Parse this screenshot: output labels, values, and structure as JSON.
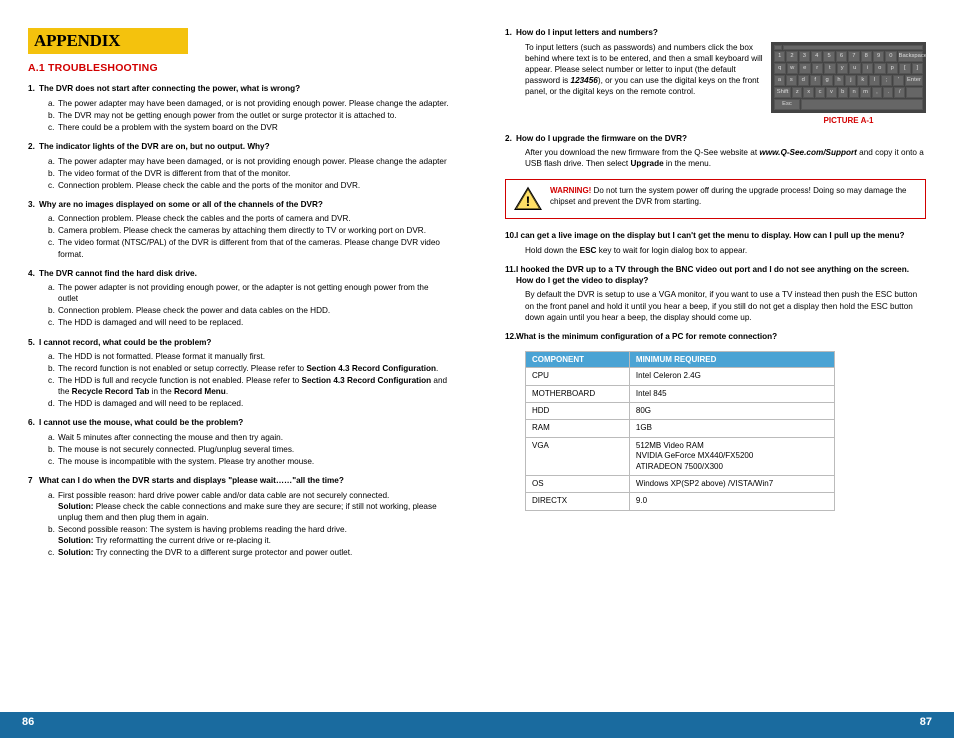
{
  "header": {
    "title": "APPENDIX"
  },
  "section": {
    "title": "A.1 TROUBLESHOOTING"
  },
  "left": {
    "q1": {
      "text": "The DVR does not start after connecting the power, what is wrong?",
      "a": "The power adapter may have been damaged, or is not providing enough power. Please change the adapter.",
      "b": "The DVR may not be getting enough power from the outlet or surge protector it is attached to.",
      "c": "There could be a problem with the system board on the DVR"
    },
    "q2": {
      "text": "The indicator lights of the DVR are on, but no output. Why?",
      "a": "The power adapter may have been damaged, or is not providing enough power. Please change the adapter",
      "b": "The video format of the DVR is different from that of the monitor.",
      "c": "Connection problem. Please check the cable and the ports of the monitor and DVR."
    },
    "q3": {
      "text": "Why are no images displayed on some or all of the channels of the DVR?",
      "a": "Connection problem. Please check the cables and the ports of camera and DVR.",
      "b": "Camera problem. Please check the cameras by attaching them directly to TV or working port on DVR.",
      "c": "The video format (NTSC/PAL) of the DVR is different from that of the cameras. Please change DVR video format."
    },
    "q4": {
      "text": "The DVR cannot find the hard disk drive.",
      "a": "The power adapter is not providing enough power, or the adapter is not getting enough power from the outlet",
      "b": "Connection problem. Please check the power and data cables on the HDD.",
      "c": "The HDD is damaged and will need to be replaced."
    },
    "q5": {
      "text": "I cannot record, what could be the problem?",
      "a": "The HDD is not formatted. Please format it manually first.",
      "b_pre": "The record function is not enabled or setup correctly. Please refer to ",
      "b_bold": "Section 4.3 Record Configuration",
      "b_post": ".",
      "c_pre": "The HDD is full and recycle function is not enabled. Please refer to ",
      "c_b1": "Section 4.3 Record Configuration",
      "c_mid": " and the ",
      "c_b2": "Recycle Record Tab",
      "c_mid2": " in the ",
      "c_b3": "Record Menu",
      "c_post": ".",
      "d": "The HDD is damaged and will need to be replaced."
    },
    "q6": {
      "text": "I cannot use the mouse, what could be the problem?",
      "a": "Wait 5 minutes after connecting the mouse and then try again.",
      "b": "The mouse is not securely connected. Plug/unplug several times.",
      "c": "The mouse is incompatible with the system. Please try another mouse."
    },
    "q7": {
      "num": "7",
      "text": "What can I do when the DVR starts and displays \"please wait……\"all the time?",
      "a_pre": "First possible reason: hard drive power cable and/or data cable are not securely connected.",
      "a_sol_label": "Solution:",
      "a_sol": " Please check the cable connections and make sure they are secure; if still not working, please unplug them and then plug them in again.",
      "b_pre": "Second possible reason: The system is having problems reading the hard drive.",
      "b_sol_label": "Solution:",
      "b_sol": " Try reformatting the current drive or re-placing it.",
      "c_label": "Solution:",
      "c_sol": " Try connecting the DVR to a different surge protector and power outlet."
    }
  },
  "right": {
    "q8": {
      "text": "How do I input letters and numbers?",
      "body_pre": "To input letters (such as passwords) and numbers click the box behind where text is to be entered, and then a small keyboard will appear. Please select number or letter to input (the default password is ",
      "pw": "123456",
      "body_post": "), or you can use the digital keys on the front panel, or the digital keys on the remote control."
    },
    "kb_caption": "PICTURE A-1",
    "kb": {
      "r1": [
        "1",
        "2",
        "3",
        "4",
        "5",
        "6",
        "7",
        "8",
        "9",
        "0"
      ],
      "r1_end": "Backspace",
      "r2": [
        "q",
        "w",
        "e",
        "r",
        "t",
        "y",
        "u",
        "i",
        "o",
        "p",
        "[",
        "]"
      ],
      "r3_start": "",
      "r3": [
        "a",
        "s",
        "d",
        "f",
        "g",
        "h",
        "j",
        "k",
        "l",
        ";",
        "'"
      ],
      "r3_end": "Enter",
      "r4_start": "Shift",
      "r4": [
        "z",
        "x",
        "c",
        "v",
        "b",
        "n",
        "m",
        ",",
        ".",
        "/"
      ],
      "r5_start": "Esc"
    },
    "q9": {
      "text": "How do I upgrade the firmware on the DVR?",
      "body_pre": "After you download the new firmware from the Q-See website at ",
      "url": "www.Q-See.com/Support",
      "body_mid": " and copy it onto a USB flash drive. Then select ",
      "upgrade": "Upgrade",
      "body_post": " in the menu."
    },
    "warning": {
      "label": "WARNING!",
      "text": " Do not turn the system power off during the upgrade process! Doing so may damage the chipset and prevent the DVR from starting."
    },
    "q10": {
      "text": "I can get a live image on the display but I can't get the menu to display. How can I pull up the menu?",
      "body_pre": "Hold down the ",
      "esc": "ESC",
      "body_post": " key to wait for login dialog box to appear."
    },
    "q11": {
      "text": "I hooked the DVR up to a TV through the BNC video out port and I do not see anything on the screen. How do I get the video to display?",
      "body": "By default the DVR is setup to use a VGA monitor, if you want to use a TV instead then push the ESC button on the front panel and hold it until you hear a beep, if you still do not get a display then hold the ESC button down again until you hear a beep, the display should come up."
    },
    "q12": {
      "text": "What is the minimum configuration of a PC for remote connection?"
    },
    "table": {
      "h1": "COMPONENT",
      "h2": "MINIMUM REQUIRED",
      "rows": [
        {
          "c": "CPU",
          "v": "Intel Celeron 2.4G"
        },
        {
          "c": "MOTHERBOARD",
          "v": "Intel 845"
        },
        {
          "c": "HDD",
          "v": "80G"
        },
        {
          "c": "RAM",
          "v": "1GB"
        },
        {
          "c": "VGA",
          "v": "512MB Video RAM\nNVIDIA GeForce MX440/FX5200\nATIRADEON 7500/X300"
        },
        {
          "c": "OS",
          "v": "Windows XP(SP2 above) /VISTA/Win7"
        },
        {
          "c": "DIRECTX",
          "v": "9.0"
        }
      ]
    }
  },
  "pages": {
    "left": "86",
    "right": "87"
  }
}
